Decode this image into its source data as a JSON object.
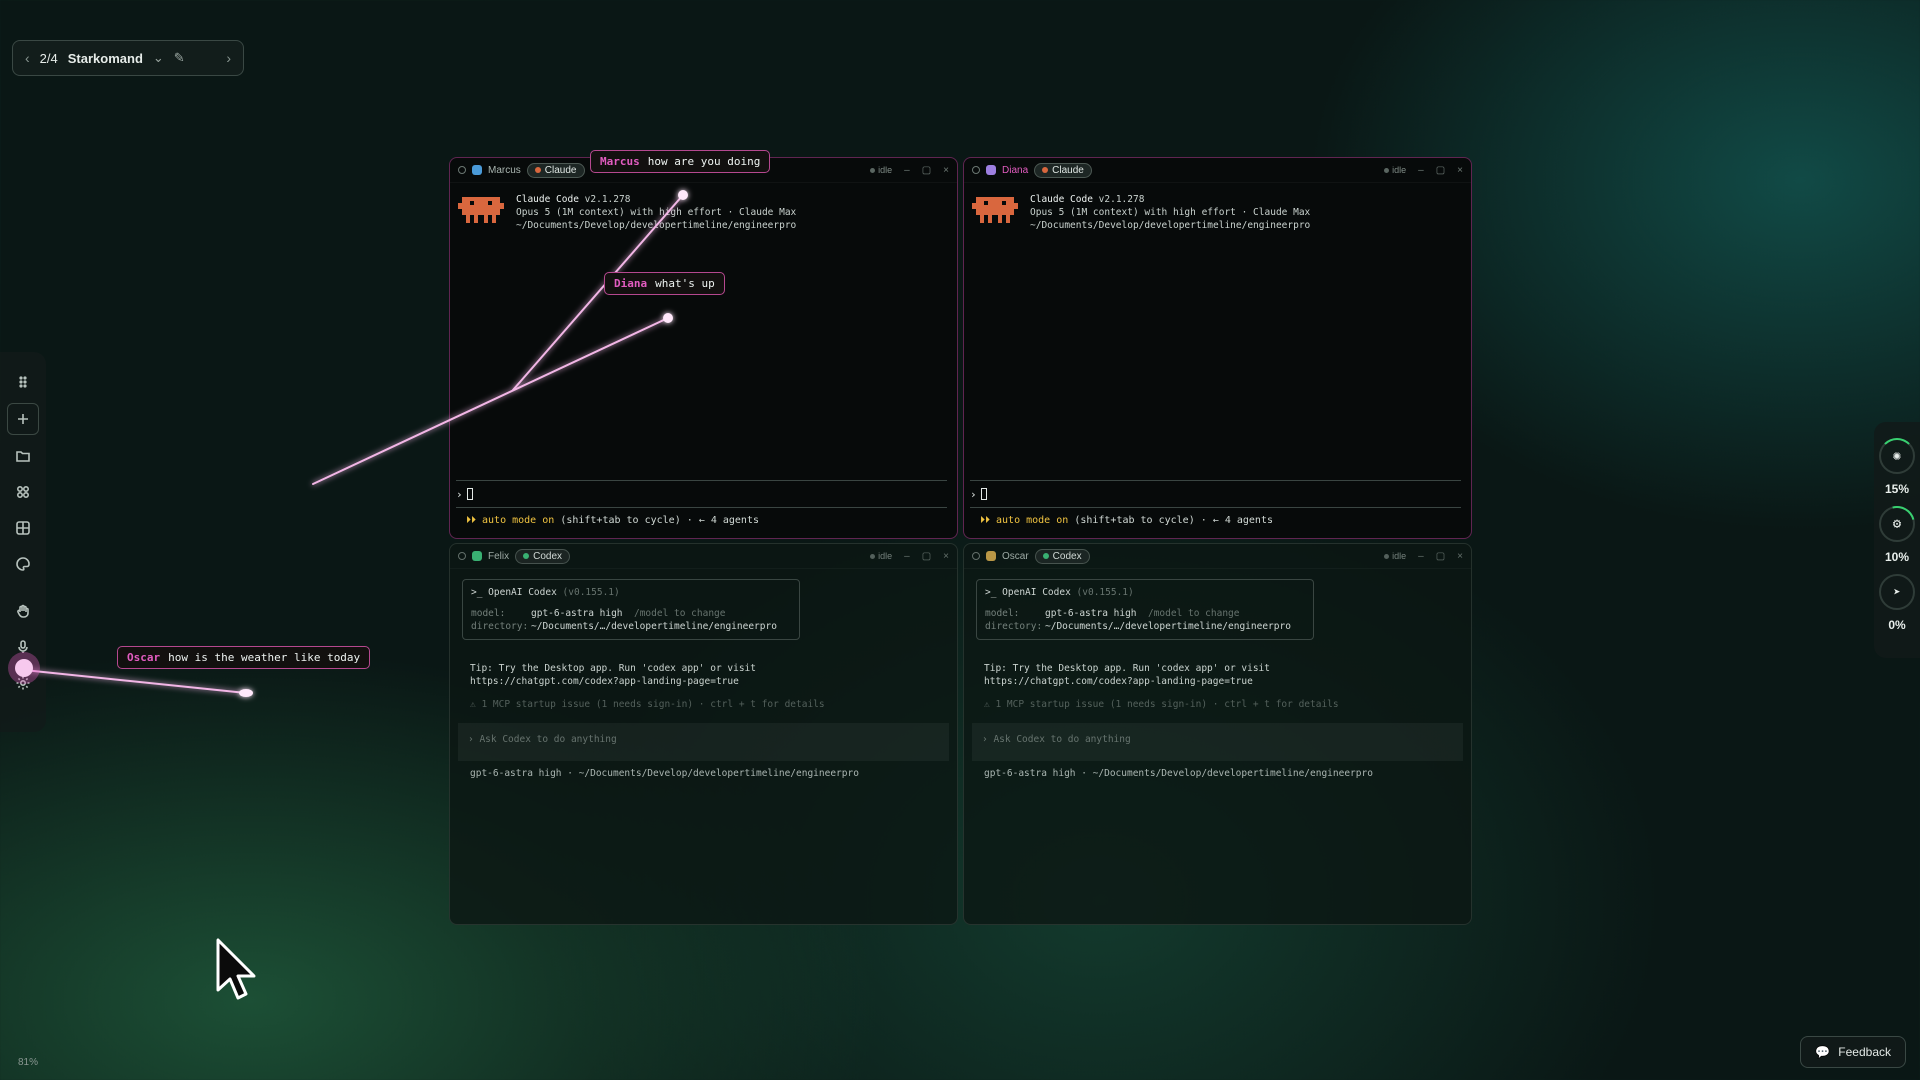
{
  "workspace": {
    "position": "2/4",
    "name": "Starkomand"
  },
  "zoom": "81%",
  "feedback_label": "Feedback",
  "stats": [
    {
      "icon": "cpu-icon",
      "value": "15%"
    },
    {
      "icon": "memory-icon",
      "value": "10%"
    },
    {
      "icon": "pointer-icon",
      "value": "0%"
    }
  ],
  "panes": {
    "marcus": {
      "name": "Marcus",
      "agent": "Claude",
      "status": "idle",
      "line1_title": "Claude Code",
      "line1_ver": "v2.1.278",
      "line2": "Opus 5 (1M context) with high effort · Claude Max",
      "line3": "~/Documents/Develop/developertimeline/engineerpro",
      "prompt": "›",
      "auto_label": "⏵⏵ auto mode on",
      "auto_hint": "(shift+tab to cycle) · ← 4 agents"
    },
    "diana": {
      "name": "Diana",
      "agent": "Claude",
      "status": "idle",
      "line1_title": "Claude Code",
      "line1_ver": "v2.1.278",
      "line2": "Opus 5 (1M context) with high effort · Claude Max",
      "line3": "~/Documents/Develop/developertimeline/engineerpro",
      "prompt": "›",
      "auto_label": "⏵⏵ auto mode on",
      "auto_hint": "(shift+tab to cycle) · ← 4 agents"
    },
    "felix": {
      "name": "Felix",
      "agent": "Codex",
      "status": "idle",
      "box_title": ">_ OpenAI Codex",
      "box_ver": "(v0.155.1)",
      "model_key": "model:",
      "model_val": "gpt-6-astra high",
      "model_hint": "/model to change",
      "dir_key": "directory:",
      "dir_val": "~/Documents/…/developertimeline/engineerpro",
      "tip1": "Tip: Try the Desktop app. Run 'codex app' or visit",
      "tip2": "https://chatgpt.com/codex?app-landing-page=true",
      "warn": "⚠ 1 MCP startup issue (1 needs sign-in) · ctrl + t for details",
      "ask": "› Ask Codex to do anything",
      "footer": "gpt-6-astra high · ~/Documents/Develop/developertimeline/engineerpro"
    },
    "oscar": {
      "name": "Oscar",
      "agent": "Codex",
      "status": "idle",
      "box_title": ">_ OpenAI Codex",
      "box_ver": "(v0.155.1)",
      "model_key": "model:",
      "model_val": "gpt-6-astra high",
      "model_hint": "/model to change",
      "dir_key": "directory:",
      "dir_val": "~/Documents/…/developertimeline/engineerpro",
      "tip1": "Tip: Try the Desktop app. Run 'codex app' or visit",
      "tip2": "https://chatgpt.com/codex?app-landing-page=true",
      "warn": "⚠ 1 MCP startup issue (1 needs sign-in) · ctrl + t for details",
      "ask": "› Ask Codex to do anything",
      "footer": "gpt-6-astra high · ~/Documents/Develop/developertimeline/engineerpro"
    }
  },
  "bubbles": {
    "marcus": {
      "who": "Marcus",
      "text": "how are you doing"
    },
    "diana": {
      "who": "Diana",
      "text": "what's up"
    },
    "oscar": {
      "who": "Oscar",
      "text": "how is the weather like today"
    }
  },
  "colors": {
    "accent_pink": "#e25cc0",
    "claude_orange": "#d9673e",
    "codex_green": "#3dbd7a",
    "ring_green": "#38d070"
  }
}
